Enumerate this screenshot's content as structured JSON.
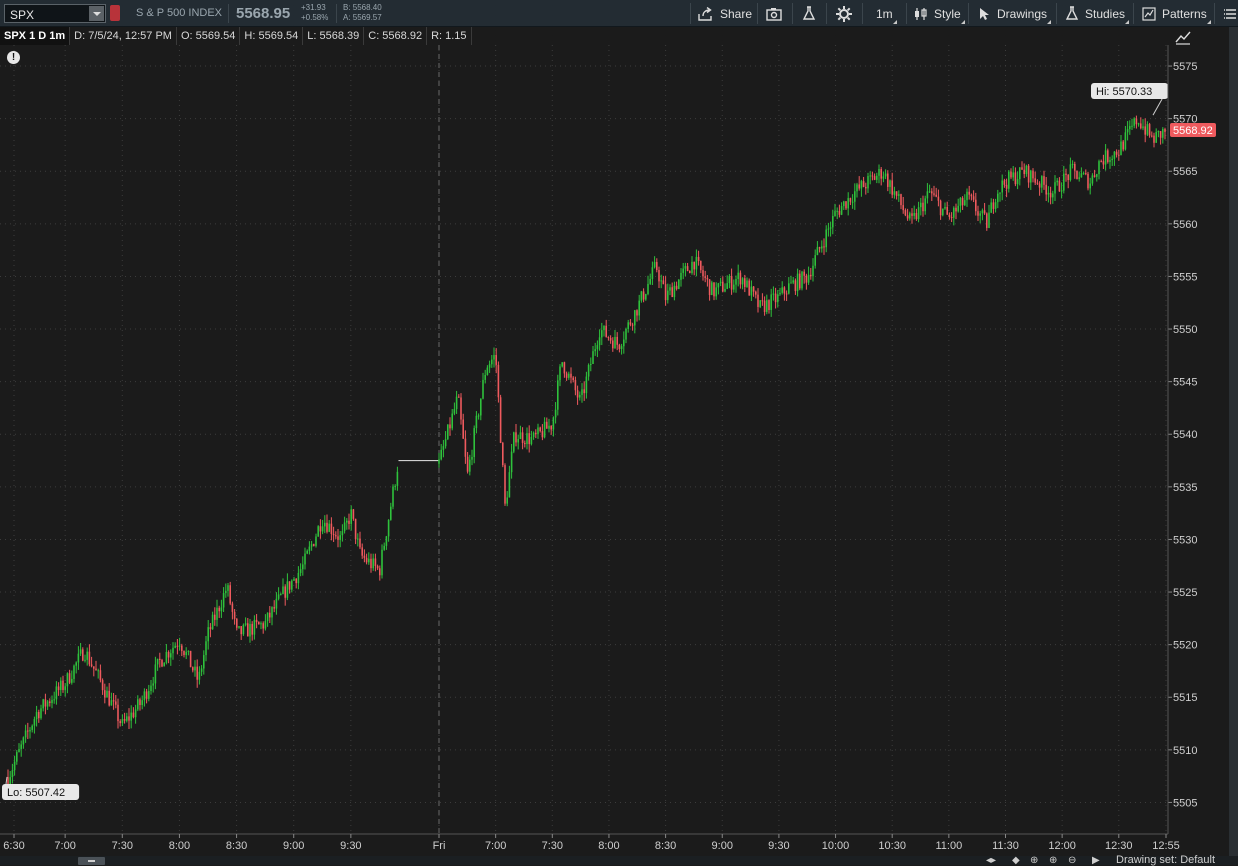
{
  "toolbar": {
    "symbol": "SPX",
    "description": "S & P 500 INDEX",
    "last_price": "5568.95",
    "net_change": "+31.93",
    "pct_change": "+0.58%",
    "bid": "B: 5568.40",
    "ask": "A: 5569.57",
    "share_label": "Share",
    "timeframe_label": "1m",
    "style_label": "Style",
    "drawings_label": "Drawings",
    "studies_label": "Studies",
    "patterns_label": "Patterns"
  },
  "infobar": {
    "chart_label": "SPX 1 D 1m",
    "date": "D: 7/5/24, 12:57 PM",
    "open": "O: 5569.54",
    "high": "H: 5569.54",
    "low": "L: 5568.39",
    "close": "C: 5568.92",
    "range": "R: 1.15"
  },
  "bottom": {
    "drawing_set": "Drawing set: Default"
  },
  "colors": {
    "up": "#2fc23c",
    "down": "#ef5a5e",
    "background": "#1b1b1b",
    "grid": "#3c3c3c"
  },
  "chart_data": {
    "type": "candlestick",
    "title": "",
    "ylim": [
      5502,
      5577
    ],
    "y_ticks": [
      5505,
      5510,
      5515,
      5520,
      5525,
      5530,
      5535,
      5540,
      5545,
      5550,
      5555,
      5560,
      5565,
      5570,
      5575
    ],
    "x_tick_labels": [
      "6:30",
      "7:00",
      "7:30",
      "8:00",
      "8:30",
      "9:00",
      "9:30",
      "Fri",
      "7:00",
      "7:30",
      "8:00",
      "8:30",
      "9:00",
      "9:30",
      "10:00",
      "10:30",
      "11:00",
      "11:30",
      "12:00",
      "12:30",
      "12:55"
    ],
    "session_break_label": "Fri",
    "hi_label": "Hi: 5570.33",
    "lo_label": "Lo: 5507.42",
    "hi_value": 5570.33,
    "lo_value": 5507.42,
    "last_value": 5568.92,
    "last_label": "5568.92",
    "series": [
      {
        "name": "",
        "session": "thu",
        "times": [
          "6:30",
          "6:45",
          "7:00",
          "7:10",
          "7:20",
          "7:30",
          "7:40",
          "7:50",
          "8:00",
          "8:10",
          "8:15",
          "8:25",
          "8:30",
          "8:45",
          "8:55",
          "9:05",
          "9:15",
          "9:25",
          "9:30",
          "9:35",
          "9:45",
          "9:55"
        ],
        "values": [
          5507.4,
          5513.5,
          5516.3,
          5519.5,
          5516,
          5512.3,
          5514.5,
          5518.5,
          5520.5,
          5516.5,
          5521,
          5525.5,
          5521,
          5522,
          5525,
          5527.5,
          5532,
          5530,
          5532.5,
          5528.5,
          5527,
          5537.5
        ]
      },
      {
        "name": "",
        "session": "fri",
        "times": [
          "6:30",
          "6:40",
          "6:45",
          "6:55",
          "7:00",
          "7:05",
          "7:10",
          "7:20",
          "7:30",
          "7:35",
          "7:45",
          "7:55",
          "8:05",
          "8:15",
          "8:25",
          "8:30",
          "8:45",
          "8:55",
          "9:10",
          "9:20",
          "9:30",
          "9:35",
          "9:45",
          "10:00",
          "10:10",
          "10:25",
          "10:40",
          "10:50",
          "11:00",
          "11:10",
          "11:20",
          "11:25",
          "11:30",
          "11:40",
          "11:55",
          "12:05",
          "12:15",
          "12:20",
          "12:30",
          "12:40",
          "12:48",
          "12:55"
        ],
        "values": [
          5537.2,
          5543.5,
          5536,
          5546.5,
          5547.5,
          5533,
          5540,
          5539.5,
          5541,
          5547,
          5543,
          5550,
          5548.5,
          5552,
          5556,
          5553,
          5556.5,
          5553.5,
          5555,
          5552,
          5553,
          5554,
          5555,
          5561,
          5563,
          5565,
          5560,
          5563,
          5560.5,
          5562.5,
          5560,
          5563,
          5564,
          5565,
          5563,
          5565,
          5564,
          5566,
          5567,
          5570,
          5568,
          5568.9
        ]
      }
    ]
  }
}
